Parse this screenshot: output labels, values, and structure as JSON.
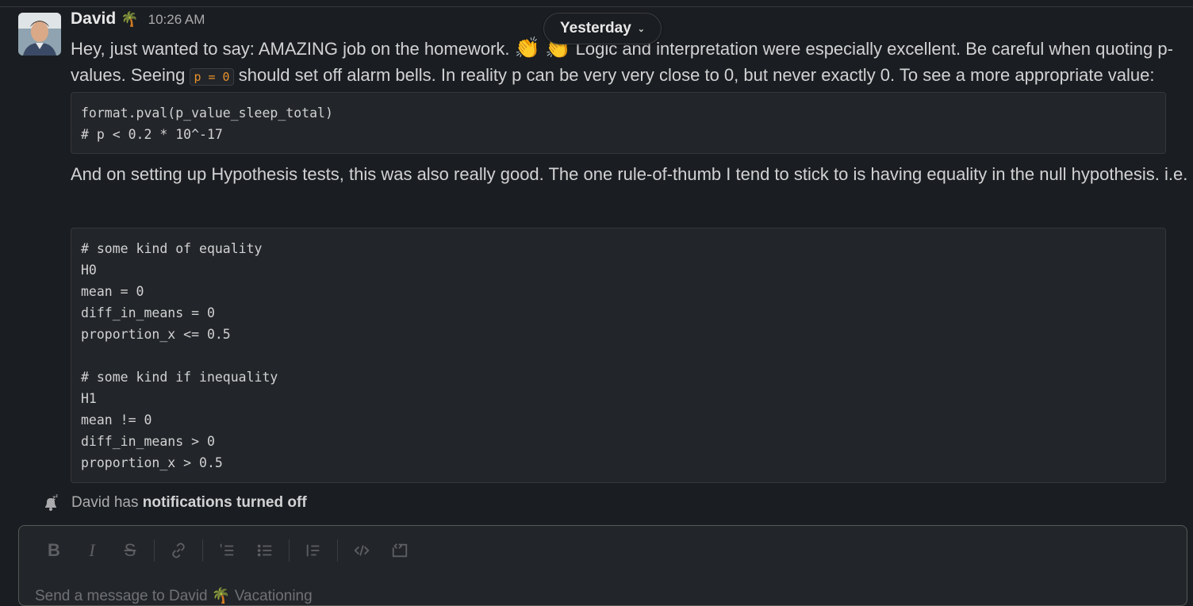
{
  "message": {
    "sender": "David",
    "sender_status_emoji": "🌴",
    "time": "10:26 AM",
    "p1_part1": "Hey, just wanted to say: AMAZING job on the homework. ",
    "p1_emoji1": "👏",
    "p1_emoji2": "👏",
    "p1_part2": " Logic and interpretation were especially excellent. Be careful when quoting p-values. Seeing ",
    "p1_code": "p = 0",
    "p1_part3": " should set off alarm bells. In reality p can be very very close to 0, but never exactly 0. To see a more appropriate value:",
    "code1": "format.pval(p_value_sleep_total)\n# p < 0.2 * 10^-17",
    "p2": "And on setting up Hypothesis tests, this was also really good. The one rule-of-thumb I tend to stick to is having equality in the null hypothesis. i.e.",
    "code2": "# some kind of equality\nH0\nmean = 0\ndiff_in_means = 0\nproportion_x <= 0.5\n\n# some kind if inequality\nH1\nmean != 0\ndiff_in_means > 0\nproportion_x > 0.5"
  },
  "date_divider": {
    "label": "Yesterday"
  },
  "notification": {
    "prefix": "David has ",
    "bold": "notifications turned off"
  },
  "composer": {
    "placeholder": "Send a message to David 🌴 Vacationing",
    "toolbar": [
      "bold-icon",
      "italic-icon",
      "strikethrough-icon",
      "link-icon",
      "ordered-list-icon",
      "bullet-list-icon",
      "blockquote-icon",
      "code-icon",
      "code-block-icon"
    ]
  },
  "colors": {
    "background": "#1a1d21",
    "code_inline": "#e8912d",
    "text": "#d1d2d3"
  }
}
